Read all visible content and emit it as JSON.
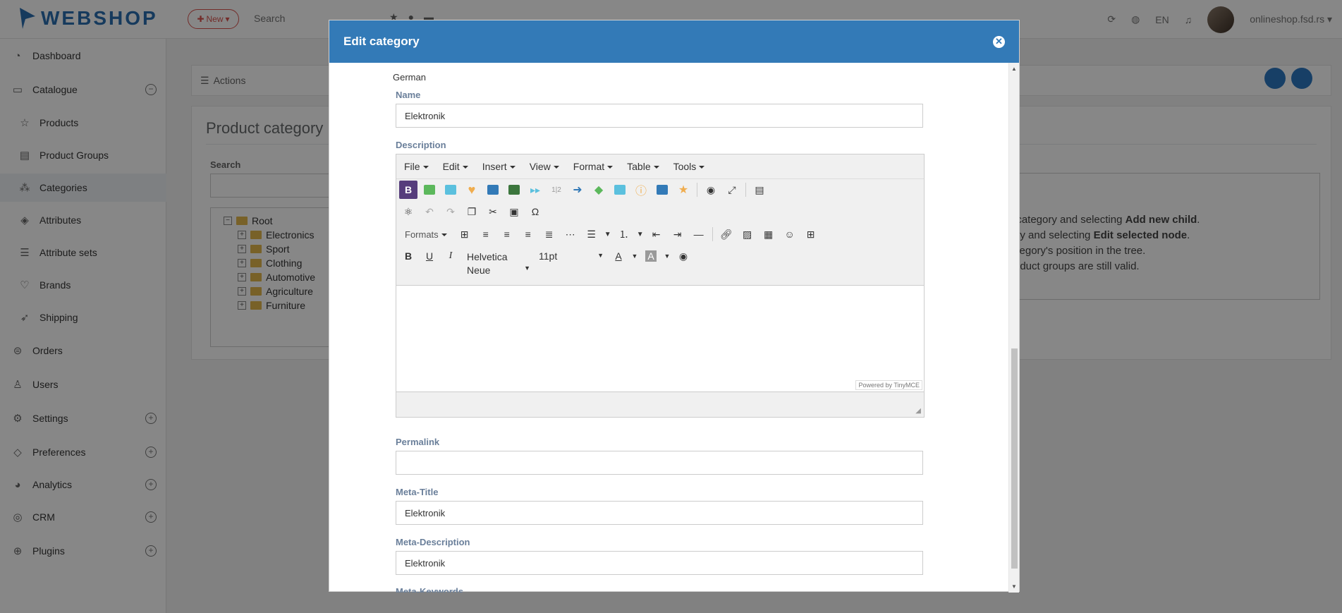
{
  "topbar": {
    "logo": "WEBSHOP",
    "new_label": "New",
    "search_placeholder": "Search",
    "language": "EN",
    "user": "onlineshop.fsd.rs"
  },
  "sidebar": {
    "items": [
      {
        "label": "Dashboard"
      },
      {
        "label": "Catalogue"
      },
      {
        "label": "Products"
      },
      {
        "label": "Product Groups"
      },
      {
        "label": "Categories"
      },
      {
        "label": "Attributes"
      },
      {
        "label": "Attribute sets"
      },
      {
        "label": "Brands"
      },
      {
        "label": "Shipping"
      },
      {
        "label": "Orders"
      },
      {
        "label": "Users"
      },
      {
        "label": "Settings"
      },
      {
        "label": "Preferences"
      },
      {
        "label": "Analytics"
      },
      {
        "label": "CRM"
      },
      {
        "label": "Plugins"
      }
    ]
  },
  "main": {
    "actions_label": "Actions",
    "panel_title": "Product category",
    "search_label": "Search",
    "tree": [
      "Root",
      "Electronics",
      "Sport",
      "Clothing",
      "Automotive",
      "Agriculture",
      "Furniture"
    ],
    "help": {
      "l1a": "t category and selecting ",
      "l1b": "Add new child",
      "l1c": ".",
      "l2a": "ory and selecting ",
      "l2b": "Edit selected node",
      "l2c": ".",
      "l3": "ategory's position in the tree.",
      "l4": "roduct groups are still valid."
    }
  },
  "modal": {
    "title": "Edit category",
    "language": "German",
    "name_label": "Name",
    "name_value": "Elektronik",
    "description_label": "Description",
    "menu": [
      "File",
      "Edit",
      "Insert",
      "View",
      "Format",
      "Table",
      "Tools"
    ],
    "formats_label": "Formats",
    "font_family": "Helvetica Neue",
    "font_size": "11pt",
    "powered_by": "Powered by TinyMCE",
    "permalink_label": "Permalink",
    "permalink_value": "",
    "meta_title_label": "Meta-Title",
    "meta_title_value": "Elektronik",
    "meta_description_label": "Meta-Description",
    "meta_description_value": "Elektronik",
    "meta_keywords_label": "Meta-Keywords"
  },
  "colors": {
    "brand": "#2a6fb0",
    "modal_header": "#337ab7",
    "new_button": "#d9534f"
  }
}
